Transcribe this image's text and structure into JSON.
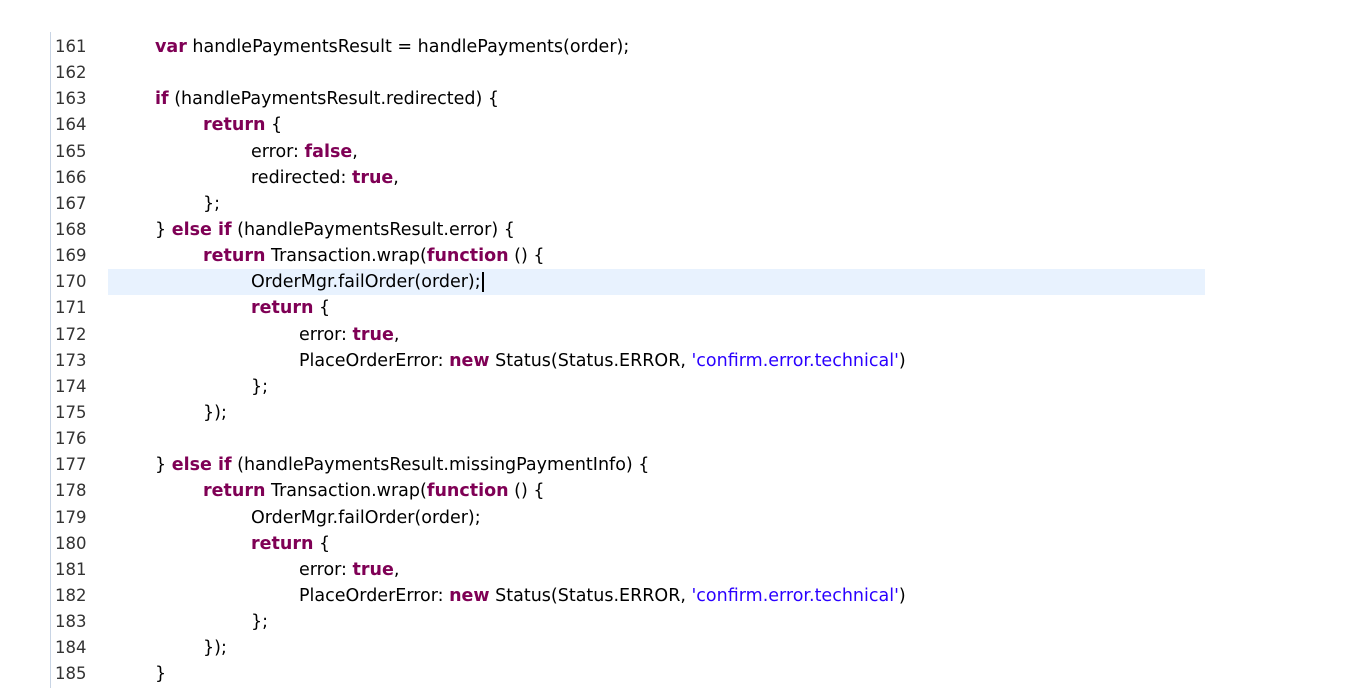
{
  "editor": {
    "current_line": "170",
    "lines": [
      {
        "num": "161",
        "indent": 0,
        "tokens": [
          [
            "kw",
            "var"
          ],
          [
            "p",
            " handlePaymentsResult = handlePayments(order);"
          ]
        ]
      },
      {
        "num": "162",
        "indent": 0,
        "tokens": []
      },
      {
        "num": "163",
        "indent": 0,
        "tokens": [
          [
            "kw",
            "if"
          ],
          [
            "p",
            " (handlePaymentsResult.redirected) {"
          ]
        ]
      },
      {
        "num": "164",
        "indent": 1,
        "tokens": [
          [
            "kw",
            "return"
          ],
          [
            "p",
            " {"
          ]
        ]
      },
      {
        "num": "165",
        "indent": 2,
        "tokens": [
          [
            "p",
            "error: "
          ],
          [
            "kw",
            "false"
          ],
          [
            "p",
            ","
          ]
        ]
      },
      {
        "num": "166",
        "indent": 2,
        "tokens": [
          [
            "p",
            "redirected: "
          ],
          [
            "kw",
            "true"
          ],
          [
            "p",
            ","
          ]
        ]
      },
      {
        "num": "167",
        "indent": 1,
        "tokens": [
          [
            "p",
            "};"
          ]
        ]
      },
      {
        "num": "168",
        "indent": 0,
        "tokens": [
          [
            "p",
            "} "
          ],
          [
            "kw",
            "else if"
          ],
          [
            "p",
            " (handlePaymentsResult.error) {"
          ]
        ]
      },
      {
        "num": "169",
        "indent": 1,
        "tokens": [
          [
            "kw",
            "return"
          ],
          [
            "p",
            " Transaction.wrap("
          ],
          [
            "kw",
            "function"
          ],
          [
            "p",
            " () {"
          ]
        ]
      },
      {
        "num": "170",
        "indent": 2,
        "tokens": [
          [
            "p",
            "OrderMgr.failOrder(order);"
          ]
        ],
        "caret": true
      },
      {
        "num": "171",
        "indent": 2,
        "tokens": [
          [
            "kw",
            "return"
          ],
          [
            "p",
            " {"
          ]
        ]
      },
      {
        "num": "172",
        "indent": 3,
        "tokens": [
          [
            "p",
            "error: "
          ],
          [
            "kw",
            "true"
          ],
          [
            "p",
            ","
          ]
        ]
      },
      {
        "num": "173",
        "indent": 3,
        "tokens": [
          [
            "p",
            "PlaceOrderError: "
          ],
          [
            "kw",
            "new"
          ],
          [
            "p",
            " Status(Status.ERROR, "
          ],
          [
            "str",
            "'confirm.error.technical'"
          ],
          [
            "p",
            ")"
          ]
        ]
      },
      {
        "num": "174",
        "indent": 2,
        "tokens": [
          [
            "p",
            "};"
          ]
        ]
      },
      {
        "num": "175",
        "indent": 1,
        "tokens": [
          [
            "p",
            "});"
          ]
        ]
      },
      {
        "num": "176",
        "indent": 0,
        "tokens": []
      },
      {
        "num": "177",
        "indent": 0,
        "tokens": [
          [
            "p",
            "} "
          ],
          [
            "kw",
            "else if"
          ],
          [
            "p",
            " (handlePaymentsResult.missingPaymentInfo) {"
          ]
        ]
      },
      {
        "num": "178",
        "indent": 1,
        "tokens": [
          [
            "kw",
            "return"
          ],
          [
            "p",
            " Transaction.wrap("
          ],
          [
            "kw",
            "function"
          ],
          [
            "p",
            " () {"
          ]
        ]
      },
      {
        "num": "179",
        "indent": 2,
        "tokens": [
          [
            "p",
            "OrderMgr.failOrder(order);"
          ]
        ]
      },
      {
        "num": "180",
        "indent": 2,
        "tokens": [
          [
            "kw",
            "return"
          ],
          [
            "p",
            " {"
          ]
        ]
      },
      {
        "num": "181",
        "indent": 3,
        "tokens": [
          [
            "p",
            "error: "
          ],
          [
            "kw",
            "true"
          ],
          [
            "p",
            ","
          ]
        ]
      },
      {
        "num": "182",
        "indent": 3,
        "tokens": [
          [
            "p",
            "PlaceOrderError: "
          ],
          [
            "kw",
            "new"
          ],
          [
            "p",
            " Status(Status.ERROR, "
          ],
          [
            "str",
            "'confirm.error.technical'"
          ],
          [
            "p",
            ")"
          ]
        ]
      },
      {
        "num": "183",
        "indent": 2,
        "tokens": [
          [
            "p",
            "};"
          ]
        ]
      },
      {
        "num": "184",
        "indent": 1,
        "tokens": [
          [
            "p",
            "});"
          ]
        ]
      },
      {
        "num": "185",
        "indent": 0,
        "tokens": [
          [
            "p",
            "}"
          ]
        ]
      }
    ]
  },
  "colors": {
    "keyword": "#7f0055",
    "string": "#2a00ff",
    "plain": "#000000",
    "current_line_highlight": "#e8f2fe",
    "gutter_rule": "#c8d4e4",
    "line_number": "#333333"
  }
}
